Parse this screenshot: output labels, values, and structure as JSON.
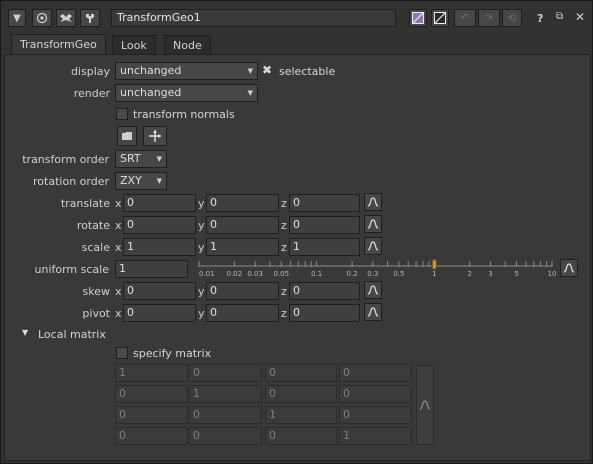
{
  "node_name": "TransformGeo1",
  "tabs": [
    "TransformGeo",
    "Look",
    "Node"
  ],
  "display": {
    "label": "display",
    "value": "unchanged"
  },
  "selectable_label": "selectable",
  "render": {
    "label": "render",
    "value": "unchanged"
  },
  "transform_normals_label": "transform normals",
  "transform_order": {
    "label": "transform order",
    "value": "SRT"
  },
  "rotation_order": {
    "label": "rotation order",
    "value": "ZXY"
  },
  "translate": {
    "label": "translate",
    "x": "0",
    "y": "0",
    "z": "0"
  },
  "rotate": {
    "label": "rotate",
    "x": "0",
    "y": "0",
    "z": "0"
  },
  "scale": {
    "label": "scale",
    "x": "1",
    "y": "1",
    "z": "1"
  },
  "uniform_scale": {
    "label": "uniform scale",
    "value": "1",
    "slider_value": 1,
    "ticks": [
      "0.01",
      "0.02",
      "0.03",
      "0.05",
      "0.1",
      "0.2",
      "0.3",
      "0.5",
      "1",
      "2",
      "3",
      "5",
      "10"
    ]
  },
  "skew": {
    "label": "skew",
    "x": "0",
    "y": "0",
    "z": "0"
  },
  "pivot": {
    "label": "pivot",
    "x": "0",
    "y": "0",
    "z": "0"
  },
  "local_matrix": {
    "label": "Local matrix",
    "specify_label": "specify matrix",
    "rows": [
      [
        "1",
        "0",
        "0",
        "0"
      ],
      [
        "0",
        "1",
        "0",
        "0"
      ],
      [
        "0",
        "0",
        "1",
        "0"
      ],
      [
        "0",
        "0",
        "0",
        "1"
      ]
    ]
  },
  "axes": {
    "x": "x",
    "y": "y",
    "z": "z"
  },
  "colors": {
    "panel": "#393939",
    "field": "#3f3f3f",
    "accent": "#c89a3c"
  }
}
